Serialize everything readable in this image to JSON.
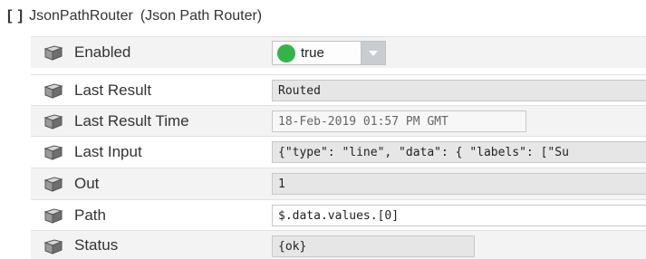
{
  "header": {
    "braces": "[ ]",
    "name": "JsonPathRouter",
    "type": "(Json Path Router)"
  },
  "properties": [
    {
      "icon": "slot-icon",
      "label": "Enabled",
      "value": "true",
      "status_color": "#33b44a"
    },
    {
      "icon": "slot-icon",
      "label": "Last Result",
      "value": "Routed"
    },
    {
      "icon": "slot-icon",
      "label": "Last Result Time",
      "value": "18-Feb-2019 01:57 PM GMT"
    },
    {
      "icon": "slot-icon",
      "label": "Last Input",
      "value": "{\"type\": \"line\", \"data\": { \"labels\": [\"Su"
    },
    {
      "icon": "slot-icon",
      "label": "Out",
      "value": "1"
    },
    {
      "icon": "slot-icon",
      "label": "Path",
      "value": "$.data.values.[0]"
    },
    {
      "icon": "slot-icon",
      "label": "Status",
      "value": "{ok}"
    }
  ]
}
